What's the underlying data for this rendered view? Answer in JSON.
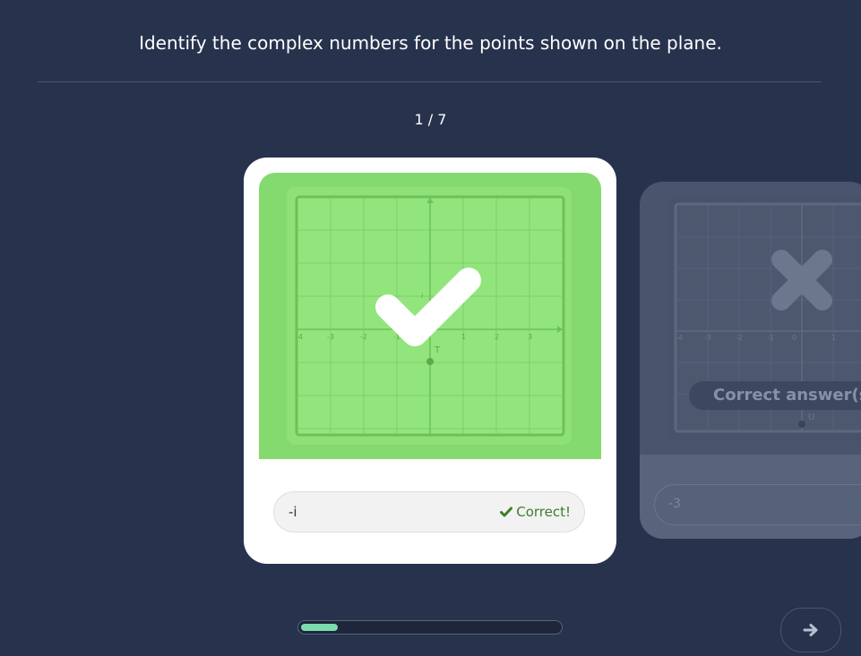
{
  "question": {
    "text": "Identify the complex numbers for the points shown on the plane."
  },
  "counter": {
    "text": "1 / 7"
  },
  "current_card": {
    "answer": "-i",
    "status_label": "Correct!",
    "status_icon": "check-icon",
    "overlay_icon": "large-check-icon",
    "plane": {
      "x_tick_labels": [
        "-4",
        "-3",
        "-2",
        "-1",
        "1",
        "2",
        "3"
      ],
      "imaginary_axis_label": "i",
      "point_label": "T",
      "point": {
        "re": 0,
        "im": -1
      }
    },
    "colors": {
      "image_bg": "#85da6f",
      "grid_bg": "#92e57c",
      "status_text": "#3d7d2b"
    }
  },
  "next_card": {
    "answer": "-3",
    "banner_label": "Correct answer(s)",
    "overlay_icon": "large-x-icon",
    "plane": {
      "x_tick_labels": [
        "-4",
        "-3",
        "-2",
        "-1",
        "0",
        "1"
      ],
      "point_label": "U"
    }
  },
  "progress": {
    "fraction": 0.143,
    "fill_color": "#7ddcae"
  },
  "navigation": {
    "next_icon": "arrow-right-icon"
  },
  "colors": {
    "background": "#27324d"
  }
}
